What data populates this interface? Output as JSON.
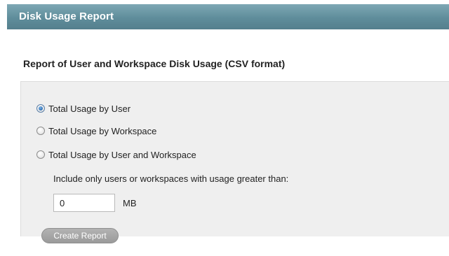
{
  "header": {
    "title": "Disk Usage Report"
  },
  "section": {
    "heading": "Report of User and Workspace Disk Usage (CSV format)"
  },
  "report_options": [
    {
      "label": "Total Usage by User",
      "checked": true
    },
    {
      "label": "Total Usage by Workspace",
      "checked": false
    },
    {
      "label": "Total Usage by User and Workspace",
      "checked": false
    }
  ],
  "threshold": {
    "label": "Include only users or workspaces with usage greater than:",
    "value": "0",
    "unit": "MB"
  },
  "actions": {
    "create_label": "Create Report"
  },
  "colors": {
    "header_bg": "#6a96a3",
    "panel_bg": "#efefef",
    "button_bg": "#a6a6a6"
  }
}
